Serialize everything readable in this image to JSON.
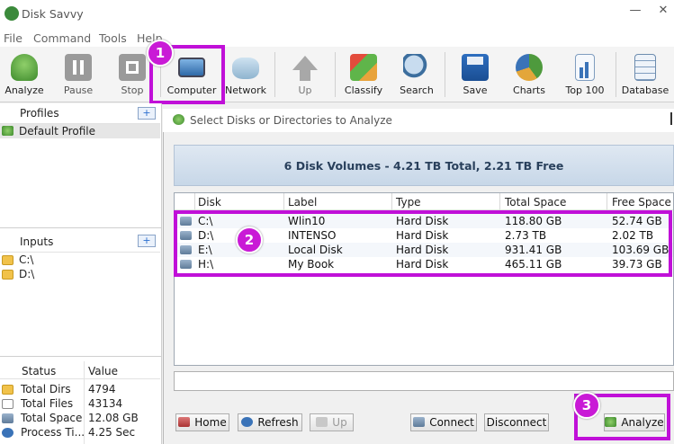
{
  "window": {
    "title": "Disk Savvy",
    "minimize": "—",
    "close": "✕"
  },
  "menu": [
    "File",
    "Command",
    "Tools",
    "Help"
  ],
  "toolbar": [
    {
      "label": "Analyze",
      "icon": "analyze-icon"
    },
    {
      "label": "Pause",
      "icon": "pause-icon"
    },
    {
      "label": "Stop",
      "icon": "stop-icon"
    },
    {
      "label": "Computer",
      "icon": "computer-icon"
    },
    {
      "label": "Network",
      "icon": "network-icon"
    },
    {
      "label": "Up",
      "icon": "up-arrow-icon"
    },
    {
      "label": "Classify",
      "icon": "classify-icon"
    },
    {
      "label": "Search",
      "icon": "search-icon"
    },
    {
      "label": "Save",
      "icon": "save-icon"
    },
    {
      "label": "Charts",
      "icon": "charts-icon"
    },
    {
      "label": "Top 100",
      "icon": "top100-icon"
    },
    {
      "label": "Database",
      "icon": "database-icon"
    }
  ],
  "profiles": {
    "title": "Profiles",
    "add": "+",
    "items": [
      "Default Profile"
    ]
  },
  "inputs": {
    "title": "Inputs",
    "add": "+",
    "items": [
      "C:\\",
      "D:\\"
    ]
  },
  "status": {
    "headers": [
      "Status",
      "Value"
    ],
    "rows": [
      [
        "Total Dirs",
        "4794"
      ],
      [
        "Total Files",
        "43134"
      ],
      [
        "Total Space",
        "12.08 GB"
      ],
      [
        "Process Ti...",
        "4.25 Sec"
      ]
    ]
  },
  "dialog": {
    "title": "Select Disks or Directories to Analyze",
    "summary": "6 Disk Volumes - 4.21 TB Total, 2.21 TB Free",
    "columns": [
      "Disk",
      "Label",
      "Type",
      "Total Space",
      "Free Space"
    ],
    "rows": [
      [
        "C:\\",
        "Wlin10",
        "Hard Disk",
        "118.80 GB",
        "52.74 GB"
      ],
      [
        "D:\\",
        "INTENSO",
        "Hard Disk",
        "2.73 TB",
        "2.02 TB"
      ],
      [
        "E:\\",
        "Local Disk",
        "Hard Disk",
        "931.41 GB",
        "103.69 GB"
      ],
      [
        "H:\\",
        "My Book",
        "Hard Disk",
        "465.11 GB",
        "39.73 GB"
      ]
    ],
    "buttons": {
      "home": "Home",
      "refresh": "Refresh",
      "up": "Up",
      "connect": "Connect",
      "disconnect": "Disconnect",
      "analyze": "Analyze"
    }
  },
  "callouts": [
    "1",
    "2",
    "3"
  ],
  "colors": {
    "highlight": "#c010d8",
    "badge": "#c91ad6"
  }
}
